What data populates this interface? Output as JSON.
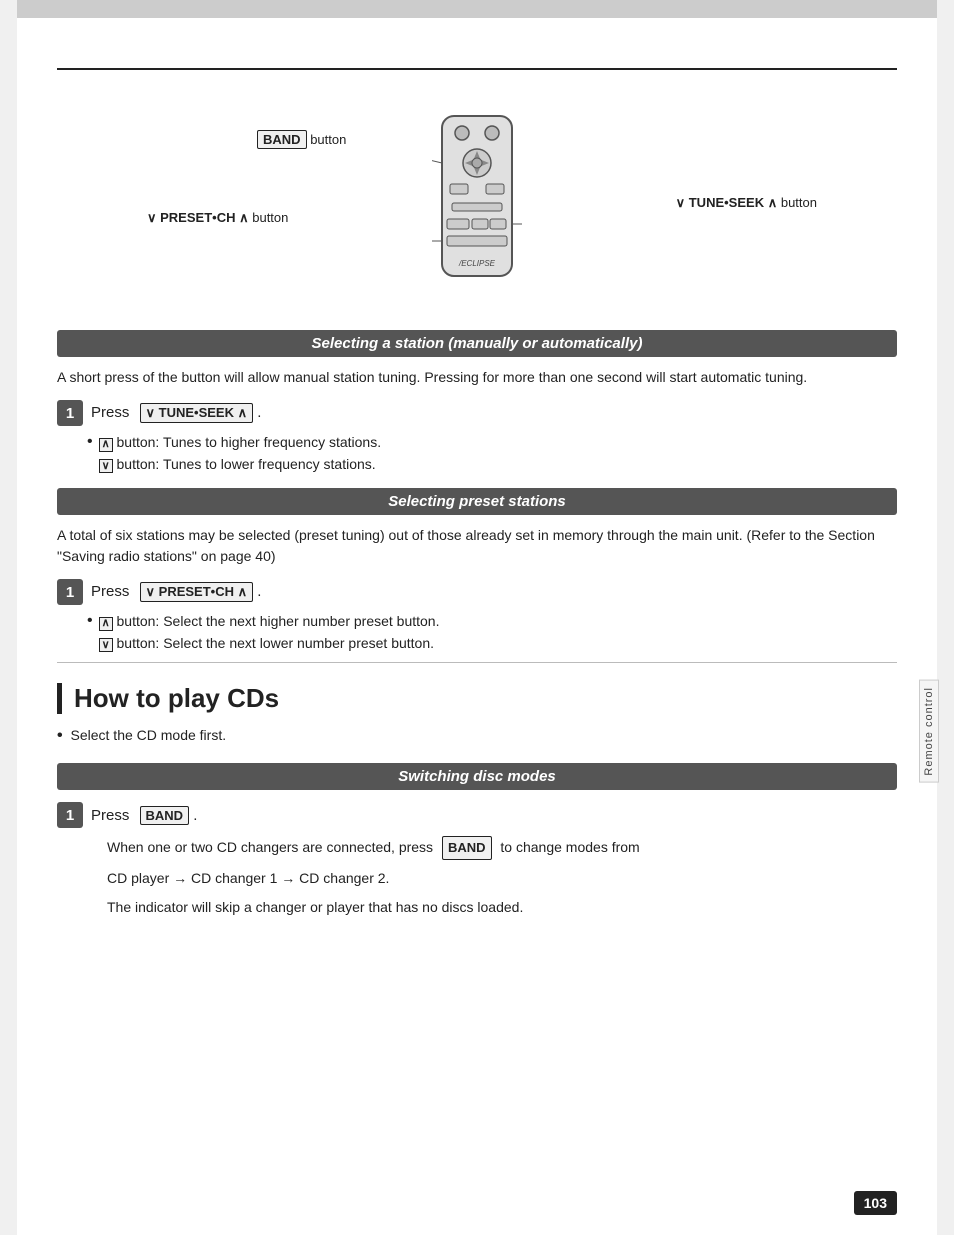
{
  "page": {
    "number": "103",
    "side_label": "Remote\ncontrol"
  },
  "diagram": {
    "band_button_label": "BAND",
    "band_suffix": "button",
    "preset_ch_label": "∨ PRESET•CH ∧",
    "preset_ch_suffix": "button",
    "tune_seek_label": "∨ TUNE•SEEK ∧",
    "tune_seek_suffix": "button"
  },
  "section1": {
    "header": "Selecting a station (manually or automatically)",
    "body": "A short press of the button will allow manual station tuning. Pressing for more than one second will start automatic tuning.",
    "step1": {
      "number": "1",
      "prefix": "Press",
      "button": "∨ TUNE•SEEK ∧",
      "suffix": "."
    },
    "bullets": [
      {
        "sym": "∧",
        "text": "button:  Tunes to higher frequency stations."
      },
      {
        "sym": "∨",
        "text": "button:  Tunes to lower frequency stations."
      }
    ]
  },
  "section2": {
    "header": "Selecting preset stations",
    "body": "A total of six stations may be selected (preset tuning) out of those already set in memory through the main unit. (Refer to the Section \"Saving radio stations\" on page 40)",
    "step1": {
      "number": "1",
      "prefix": "Press",
      "button": "∨ PRESET•CH ∧",
      "suffix": "."
    },
    "bullets": [
      {
        "sym": "∧",
        "text": "button:  Select the next higher number preset button."
      },
      {
        "sym": "∨",
        "text": "button:  Select the next lower number preset button."
      }
    ]
  },
  "section3": {
    "main_heading": "How to play CDs",
    "intro_bullet": "Select the CD mode first.",
    "subsection": {
      "header": "Switching disc modes",
      "step1": {
        "number": "1",
        "prefix": "Press",
        "button": "BAND",
        "suffix": "."
      },
      "detail_line1_prefix": "When one or two CD changers are connected, press",
      "detail_line1_button": "BAND",
      "detail_line1_suffix": "to change modes from",
      "detail_line2": "CD player → CD changer 1 → CD changer 2.",
      "detail_line3": "The indicator will skip a changer or player that has no discs loaded."
    }
  }
}
